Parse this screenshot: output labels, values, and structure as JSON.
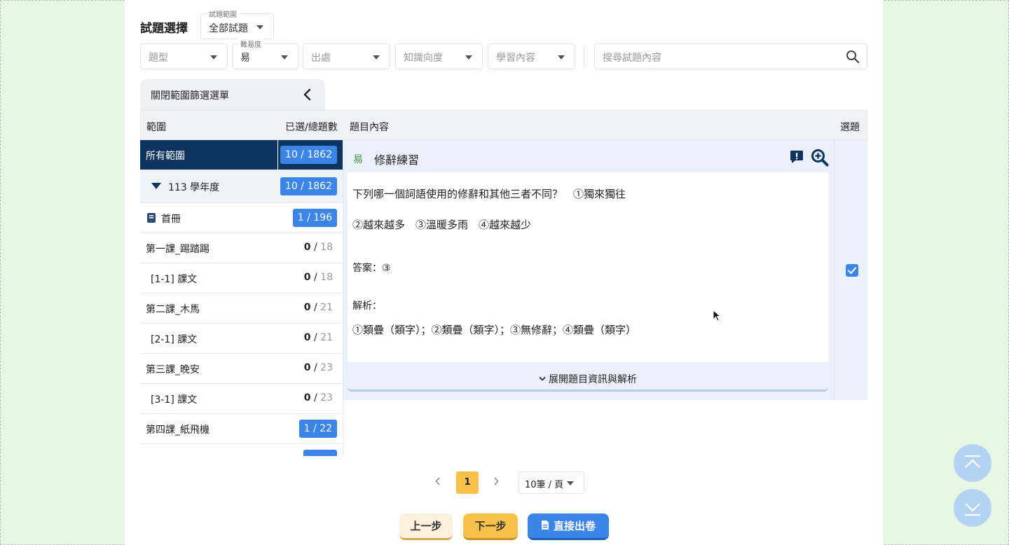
{
  "header": {
    "title": "試題選擇"
  },
  "filters": {
    "scope": {
      "label": "試題範圍",
      "value": "全部試題"
    },
    "type": {
      "placeholder": "題型"
    },
    "difficulty": {
      "label": "難易度",
      "value": "易"
    },
    "source": {
      "placeholder": "出處"
    },
    "knowledge": {
      "placeholder": "知識向度"
    },
    "learning": {
      "placeholder": "學習內容"
    },
    "search": {
      "placeholder": "搜尋試題內容"
    }
  },
  "scope_toggle": {
    "label": "關閉範圍篩選選單"
  },
  "table": {
    "headers": {
      "scope": "範圍",
      "count": "已選/總題數",
      "content": "題目內容",
      "pick": "選題"
    }
  },
  "scope_rows": [
    {
      "name": "所有範圍",
      "selected": "10",
      "total": "1862"
    },
    {
      "name": "113 學年度",
      "selected": "10",
      "total": "1862"
    },
    {
      "name": "首冊",
      "selected": "1",
      "total": "196"
    },
    {
      "name": "第一課_踢踏踢",
      "selected": "0",
      "total": "18"
    },
    {
      "name": "[1-1] 課文",
      "selected": "0",
      "total": "18"
    },
    {
      "name": "第二課_木馬",
      "selected": "0",
      "total": "21"
    },
    {
      "name": "[2-1] 課文",
      "selected": "0",
      "total": "21"
    },
    {
      "name": "第三課_晚安",
      "selected": "0",
      "total": "23"
    },
    {
      "name": "[3-1] 課文",
      "selected": "0",
      "total": "23"
    },
    {
      "name": "第四課_紙飛機",
      "selected": "1",
      "total": "22"
    }
  ],
  "question": {
    "difficulty_tag": "易",
    "title": "修辭練習",
    "line1": "下列哪一個詞語使用的修辭和其他三者不同？　①獨來獨往",
    "line2": "②越來越多　③溫暖多雨　④越來越少",
    "answer": "答案：③",
    "analysis_label": "解析：",
    "analysis": "①類疊（類字）；②類疊（類字）；③無修辭；④類疊（類字）",
    "expand_label": "展開題目資訊與解析",
    "checked": true
  },
  "pagination": {
    "current": "1",
    "page_size": "10筆 / 頁"
  },
  "actions": {
    "prev": "上一步",
    "next": "下一步",
    "direct": "直接出卷"
  },
  "colors": {
    "primary": "#3b84e8",
    "navy": "#0f3460",
    "yellow": "#f8c24a",
    "bg": "#e8f6e4"
  }
}
